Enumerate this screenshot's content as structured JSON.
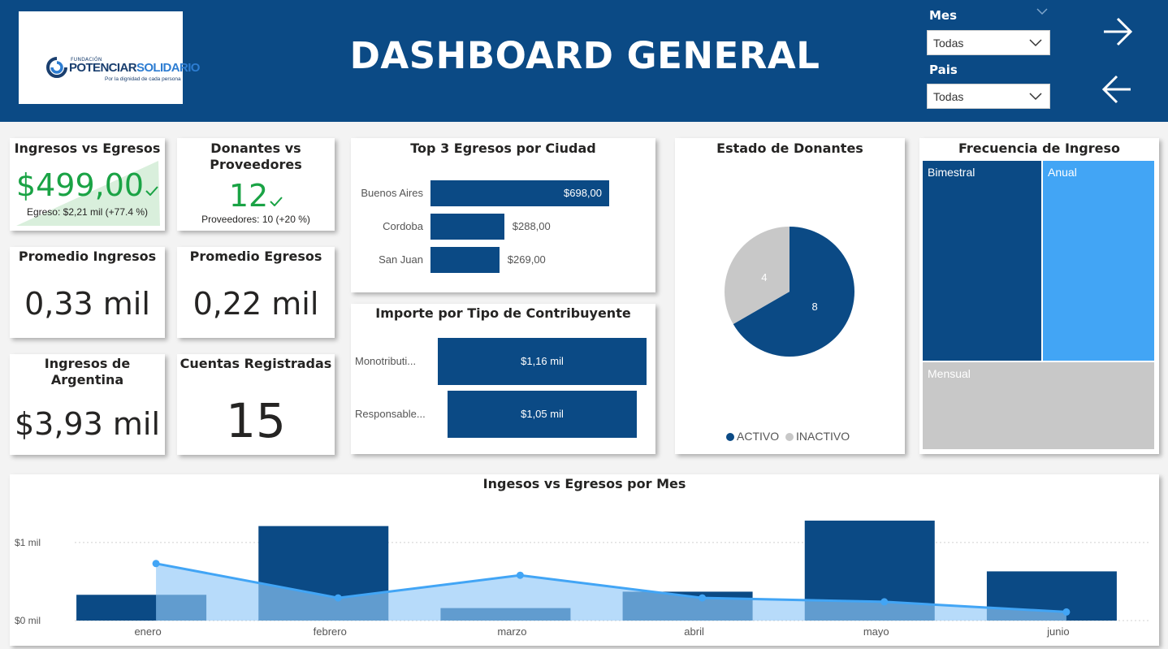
{
  "header": {
    "title": "DASHBOARD GENERAL",
    "logo": {
      "small": "FUNDACIÓN",
      "main_a": "POTENCIAR",
      "main_b": "SOLIDARIO",
      "tagline": "Por la dignidad de cada persona"
    },
    "filters": [
      {
        "label": "Mes",
        "value": "Todas"
      },
      {
        "label": "Pais",
        "value": "Todas"
      }
    ],
    "nav": {
      "next_icon": "arrow-right-icon",
      "back_icon": "arrow-left-icon"
    }
  },
  "colors": {
    "header": "#0b4a85",
    "dark_blue": "#0b4a85",
    "light_blue": "#42a5f5",
    "gray": "#c8c8c8",
    "green": "#1aa345"
  },
  "kpis": {
    "ingresos_vs_egresos": {
      "title": "Ingresos vs Egresos",
      "value": "$499,00",
      "sub": "Egreso: $2,21 mil (+77.4 %)"
    },
    "donantes_vs_proveedores": {
      "title": "Donantes vs Proveedores",
      "value": "12",
      "sub": "Proveedores: 10 (+20 %)"
    },
    "promedio_ingresos": {
      "title": "Promedio Ingresos",
      "value": "0,33 mil"
    },
    "promedio_egresos": {
      "title": "Promedio Egresos",
      "value": "0,22 mil"
    },
    "ingresos_argentina": {
      "title": "Ingresos de Argentina",
      "value": "$3,93 mil"
    },
    "cuentas_registradas": {
      "title": "Cuentas Registradas",
      "value": "15"
    }
  },
  "chart_data": [
    {
      "type": "bar",
      "title": "Top 3 Egresos por Ciudad",
      "categories": [
        "Buenos Aires",
        "Cordoba",
        "San Juan"
      ],
      "values": [
        698,
        288,
        269
      ],
      "labels": [
        "$698,00",
        "$288,00",
        "$269,00"
      ]
    },
    {
      "type": "bar",
      "title": "Importe por Tipo de Contribuyente",
      "categories": [
        "Monotributi...",
        "Responsable..."
      ],
      "values": [
        1160,
        1050
      ],
      "labels": [
        "$1,16 mil",
        "$1,05 mil"
      ]
    },
    {
      "type": "pie",
      "title": "Estado de Donantes",
      "categories": [
        "ACTIVO",
        "INACTIVO"
      ],
      "values": [
        8,
        4
      ],
      "colors": [
        "#0b4a85",
        "#c8c8c8"
      ],
      "legend_position": "bottom"
    },
    {
      "type": "heatmap",
      "title": "Frecuencia de Ingreso",
      "categories": [
        "Bimestral",
        "Anual",
        "Mensual"
      ],
      "colors": [
        "#0b4a85",
        "#42a5f5",
        "#c8c8c8"
      ]
    },
    {
      "type": "bar",
      "title": "Ingesos vs Egresos por Mes",
      "categories": [
        "enero",
        "febrero",
        "marzo",
        "abril",
        "mayo",
        "junio"
      ],
      "series": [
        {
          "type": "bar",
          "values": [
            330,
            1210,
            160,
            370,
            1280,
            630
          ]
        },
        {
          "type": "area",
          "values": [
            730,
            290,
            580,
            290,
            240,
            110
          ]
        }
      ],
      "ylim": [
        0,
        1300
      ],
      "yticks": [
        {
          "value": 0,
          "label": "$0 mil"
        },
        {
          "value": 1000,
          "label": "$1 mil"
        }
      ]
    }
  ]
}
